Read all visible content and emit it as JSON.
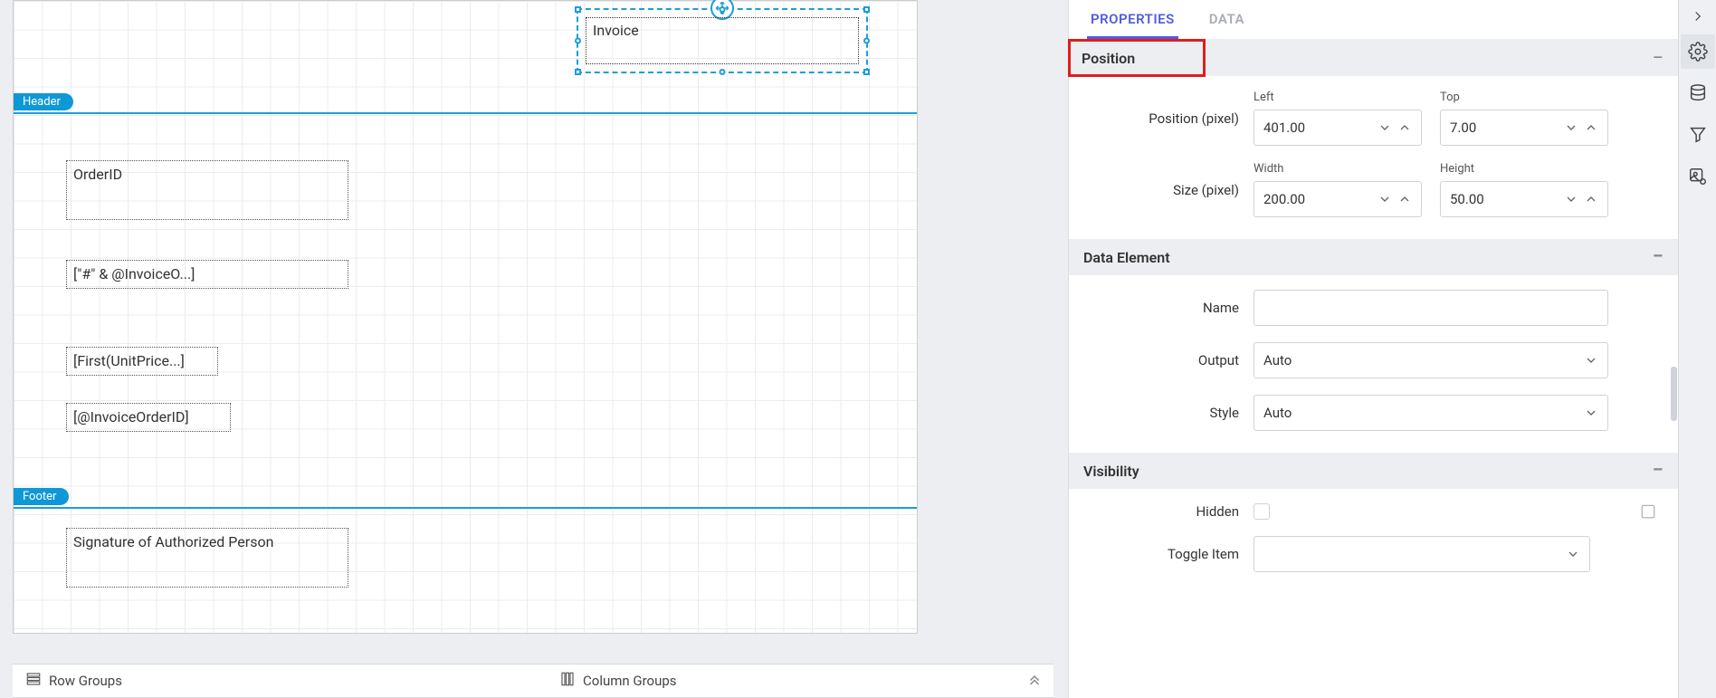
{
  "canvas": {
    "selected_text": "Invoice",
    "header_label": "Header",
    "footer_label": "Footer",
    "items": {
      "orderid": "OrderID",
      "hash": "[\"#\" & @InvoiceO...]",
      "first": "[First(UnitPrice...]",
      "at": "[@InvoiceOrderID]",
      "sig": "Signature of Authorized Person"
    }
  },
  "groups": {
    "row": "Row Groups",
    "col": "Column Groups"
  },
  "tabs": {
    "properties": "PROPERTIES",
    "data": "DATA"
  },
  "sections": {
    "position": "Position",
    "data_element": "Data Element",
    "visibility": "Visibility"
  },
  "position": {
    "row1_label": "Position (pixel)",
    "row2_label": "Size (pixel)",
    "left_cap": "Left",
    "top_cap": "Top",
    "width_cap": "Width",
    "height_cap": "Height",
    "left": "401.00",
    "top": "7.00",
    "width": "200.00",
    "height": "50.00"
  },
  "data_element": {
    "name_label": "Name",
    "name_value": "",
    "output_label": "Output",
    "output_value": "Auto",
    "style_label": "Style",
    "style_value": "Auto"
  },
  "visibility": {
    "hidden_label": "Hidden",
    "toggle_label": "Toggle Item"
  }
}
